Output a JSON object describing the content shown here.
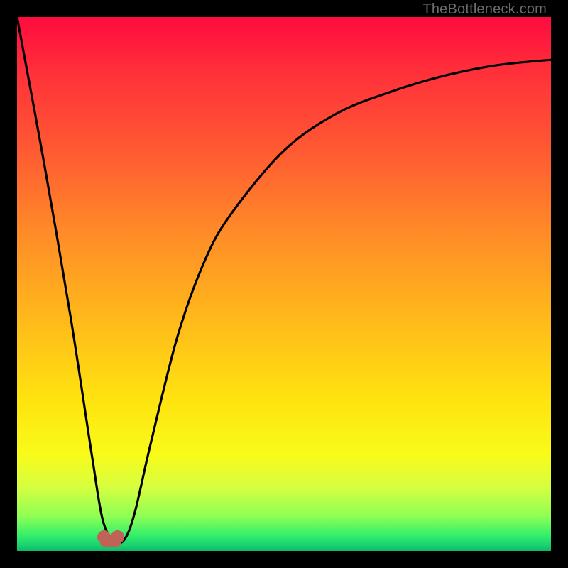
{
  "attribution": "TheBottleneck.com",
  "chart_data": {
    "type": "line",
    "title": "",
    "xlabel": "",
    "ylabel": "",
    "xlim": [
      0,
      100
    ],
    "ylim": [
      0,
      100
    ],
    "series": [
      {
        "name": "bottleneck-curve",
        "x": [
          0,
          5,
          10,
          14,
          16,
          18,
          20,
          22,
          25,
          30,
          35,
          40,
          50,
          60,
          70,
          80,
          90,
          100
        ],
        "y": [
          100,
          73,
          44,
          18,
          6,
          2,
          2,
          7,
          20,
          40,
          54,
          63,
          75,
          82,
          86,
          89,
          91,
          92
        ]
      }
    ],
    "annotations": [
      {
        "name": "min-marker",
        "x": 17.5,
        "y": 2
      }
    ],
    "background_gradient": {
      "top": "#ff0b3e",
      "mid": "#ffe40f",
      "bottom": "#11b866"
    }
  }
}
